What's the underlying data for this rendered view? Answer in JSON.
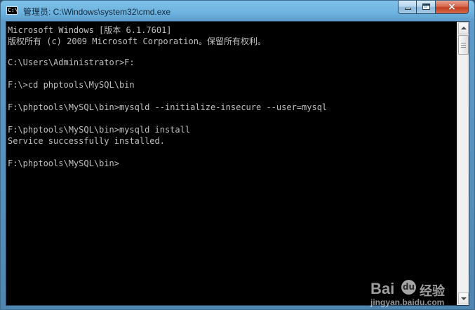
{
  "window": {
    "title": "管理员: C:\\Windows\\system32\\cmd.exe",
    "title_icon_text": "C:\\",
    "controls": {
      "minimize_icon": "minimize-icon",
      "maximize_icon": "maximize-icon",
      "close_icon": "close-icon",
      "close_glyph": "×"
    }
  },
  "console": {
    "lines": [
      "Microsoft Windows [版本 6.1.7601]",
      "版权所有 (c) 2009 Microsoft Corporation。保留所有权利。",
      "",
      "C:\\Users\\Administrator>F:",
      "",
      "F:\\>cd phptools\\MySQL\\bin",
      "",
      "F:\\phptools\\MySQL\\bin>mysqld --initialize-insecure --user=mysql",
      "",
      "F:\\phptools\\MySQL\\bin>mysqld install",
      "Service successfully installed.",
      "",
      "F:\\phptools\\MySQL\\bin>"
    ]
  },
  "watermark": {
    "brand_text": "Bai",
    "paw_text": "du",
    "jingyan_text": "经验",
    "url": "jingyan.baidu.com"
  },
  "colors": {
    "console_background": "#000000",
    "console_text": "#c0c0c0",
    "titlebar_blue": "#6cb2df",
    "close_red": "#c13f22"
  }
}
